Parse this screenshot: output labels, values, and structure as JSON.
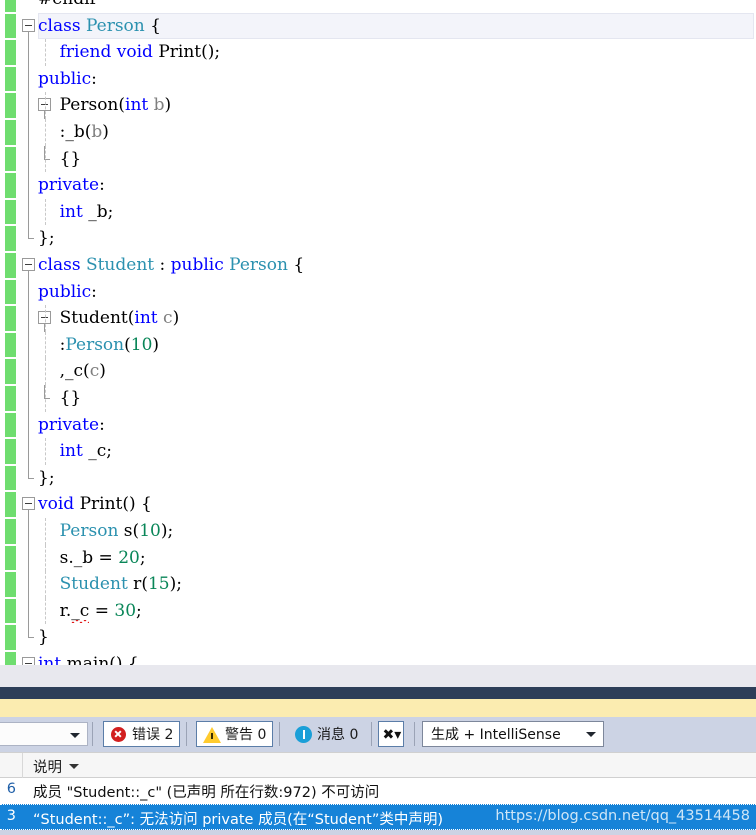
{
  "editor": {
    "lines": [
      {
        "indent": 0,
        "partial_top": true,
        "tokens": [
          {
            "t": "#endif",
            "c": "pln"
          }
        ]
      },
      {
        "indent": 0,
        "outline": "start",
        "current": true,
        "tokens": [
          {
            "t": "class",
            "c": "kw"
          },
          {
            "t": " ",
            "c": "pln"
          },
          {
            "t": "Person",
            "c": "typ"
          },
          {
            "t": " {",
            "c": "pln"
          }
        ]
      },
      {
        "indent": 1,
        "outline": "line",
        "guide": true,
        "tokens": [
          {
            "t": "    ",
            "c": "pln"
          },
          {
            "t": "friend",
            "c": "kw"
          },
          {
            "t": " ",
            "c": "pln"
          },
          {
            "t": "void",
            "c": "kw"
          },
          {
            "t": " ",
            "c": "pln"
          },
          {
            "t": "Print",
            "c": "pln"
          },
          {
            "t": "();",
            "c": "pln"
          }
        ]
      },
      {
        "indent": 0,
        "outline": "line",
        "tokens": [
          {
            "t": "public",
            "c": "kw"
          },
          {
            "t": ":",
            "c": "pln"
          }
        ]
      },
      {
        "indent": 1,
        "outline": "start-inner",
        "guide": true,
        "tokens": [
          {
            "t": "    Person",
            "c": "pln"
          },
          {
            "t": "(",
            "c": "pln"
          },
          {
            "t": "int",
            "c": "kw"
          },
          {
            "t": " ",
            "c": "pln"
          },
          {
            "t": "b",
            "c": "par"
          },
          {
            "t": ")",
            "c": "pln"
          }
        ]
      },
      {
        "indent": 1,
        "outline": "line2",
        "guide": true,
        "tokens": [
          {
            "t": "    :_b",
            "c": "pln"
          },
          {
            "t": "(",
            "c": "pln"
          },
          {
            "t": "b",
            "c": "par"
          },
          {
            "t": ")",
            "c": "pln"
          }
        ]
      },
      {
        "indent": 1,
        "outline": "end-inner",
        "guide": true,
        "tokens": [
          {
            "t": "    {}",
            "c": "pln"
          }
        ]
      },
      {
        "indent": 0,
        "outline": "line",
        "tokens": [
          {
            "t": "private",
            "c": "kw"
          },
          {
            "t": ":",
            "c": "pln"
          }
        ]
      },
      {
        "indent": 1,
        "outline": "line",
        "guide": true,
        "tokens": [
          {
            "t": "    ",
            "c": "pln"
          },
          {
            "t": "int",
            "c": "kw"
          },
          {
            "t": " _b;",
            "c": "pln"
          }
        ]
      },
      {
        "indent": 0,
        "outline": "end",
        "tokens": [
          {
            "t": "};",
            "c": "pln"
          }
        ]
      },
      {
        "indent": 0,
        "outline": "start",
        "tokens": [
          {
            "t": "class",
            "c": "kw"
          },
          {
            "t": " ",
            "c": "pln"
          },
          {
            "t": "Student",
            "c": "typ"
          },
          {
            "t": " : ",
            "c": "pln"
          },
          {
            "t": "public",
            "c": "kw"
          },
          {
            "t": " ",
            "c": "pln"
          },
          {
            "t": "Person",
            "c": "typ"
          },
          {
            "t": " {",
            "c": "pln"
          }
        ]
      },
      {
        "indent": 0,
        "outline": "line",
        "tokens": [
          {
            "t": "public",
            "c": "kw"
          },
          {
            "t": ":",
            "c": "pln"
          }
        ]
      },
      {
        "indent": 1,
        "outline": "start-inner",
        "guide": true,
        "tokens": [
          {
            "t": "    Student",
            "c": "pln"
          },
          {
            "t": "(",
            "c": "pln"
          },
          {
            "t": "int",
            "c": "kw"
          },
          {
            "t": " ",
            "c": "pln"
          },
          {
            "t": "c",
            "c": "par"
          },
          {
            "t": ")",
            "c": "pln"
          }
        ]
      },
      {
        "indent": 1,
        "outline": "line2",
        "guide": true,
        "tokens": [
          {
            "t": "    :",
            "c": "pln"
          },
          {
            "t": "Person",
            "c": "typ"
          },
          {
            "t": "(",
            "c": "pln"
          },
          {
            "t": "10",
            "c": "num"
          },
          {
            "t": ")",
            "c": "pln"
          }
        ]
      },
      {
        "indent": 1,
        "outline": "line2",
        "guide": true,
        "tokens": [
          {
            "t": "    ,_c",
            "c": "pln"
          },
          {
            "t": "(",
            "c": "pln"
          },
          {
            "t": "c",
            "c": "par"
          },
          {
            "t": ")",
            "c": "pln"
          }
        ]
      },
      {
        "indent": 1,
        "outline": "end-inner",
        "guide": true,
        "tokens": [
          {
            "t": "    {}",
            "c": "pln"
          }
        ]
      },
      {
        "indent": 0,
        "outline": "line",
        "tokens": [
          {
            "t": "private",
            "c": "kw"
          },
          {
            "t": ":",
            "c": "pln"
          }
        ]
      },
      {
        "indent": 1,
        "outline": "line",
        "guide": true,
        "tokens": [
          {
            "t": "    ",
            "c": "pln"
          },
          {
            "t": "int",
            "c": "kw"
          },
          {
            "t": " _c;",
            "c": "pln"
          }
        ]
      },
      {
        "indent": 0,
        "outline": "end",
        "tokens": [
          {
            "t": "};",
            "c": "pln"
          }
        ]
      },
      {
        "indent": 0,
        "outline": "start",
        "tokens": [
          {
            "t": "void",
            "c": "kw"
          },
          {
            "t": " Print() {",
            "c": "pln"
          }
        ]
      },
      {
        "indent": 1,
        "outline": "line",
        "guide": true,
        "tokens": [
          {
            "t": "    ",
            "c": "pln"
          },
          {
            "t": "Person",
            "c": "typ"
          },
          {
            "t": " s",
            "c": "pln"
          },
          {
            "t": "(",
            "c": "pln"
          },
          {
            "t": "10",
            "c": "num"
          },
          {
            "t": ");",
            "c": "pln"
          }
        ]
      },
      {
        "indent": 1,
        "outline": "line",
        "guide": true,
        "tokens": [
          {
            "t": "    s._b = ",
            "c": "pln"
          },
          {
            "t": "20",
            "c": "num"
          },
          {
            "t": ";",
            "c": "pln"
          }
        ]
      },
      {
        "indent": 1,
        "outline": "line",
        "guide": true,
        "tokens": [
          {
            "t": "    ",
            "c": "pln"
          },
          {
            "t": "Student",
            "c": "typ"
          },
          {
            "t": " r",
            "c": "pln"
          },
          {
            "t": "(",
            "c": "pln"
          },
          {
            "t": "15",
            "c": "num"
          },
          {
            "t": ");",
            "c": "pln"
          }
        ]
      },
      {
        "indent": 1,
        "outline": "line",
        "guide": true,
        "tokens": [
          {
            "t": "    r.",
            "c": "pln"
          },
          {
            "t": "_c",
            "c": "pln",
            "squiggle": true
          },
          {
            "t": " = ",
            "c": "pln"
          },
          {
            "t": "30",
            "c": "num"
          },
          {
            "t": ";",
            "c": "pln"
          }
        ]
      },
      {
        "indent": 0,
        "outline": "end",
        "tokens": [
          {
            "t": "}",
            "c": "pln"
          }
        ]
      },
      {
        "indent": 0,
        "outline": "start",
        "clipped_bottom": true,
        "tokens": [
          {
            "t": "int",
            "c": "kw"
          },
          {
            "t": " main() {",
            "c": "pln"
          }
        ]
      }
    ]
  },
  "error_list": {
    "toolbar": {
      "left_combo_value": "",
      "error_button": {
        "label": "错误 2",
        "icon": "error-circle-icon"
      },
      "warning_button": {
        "label": "警告 0",
        "icon": "warning-triangle-icon"
      },
      "message_button": {
        "label": "消息 0",
        "icon": "info-circle-icon"
      },
      "filter_button": {
        "icon": "clear-filter-icon"
      },
      "scope_combo": {
        "value": "生成 + IntelliSense",
        "icon": "chevron-down-icon"
      }
    },
    "columns": [
      {
        "label": "说明",
        "sortable": true
      }
    ],
    "rows": [
      {
        "code": "6",
        "description": "成员 \"Student::_c\" (已声明 所在行数:972) 不可访问",
        "selected": false
      },
      {
        "code": "3",
        "description": "“Student::_c”: 无法访问 private 成员(在“Student”类中声明)",
        "selected": true
      }
    ],
    "watermark": "https://blog.csdn.net/qq_43514458"
  },
  "colors": {
    "keyword": "#0000ff",
    "type": "#2b91af",
    "number": "#098658",
    "parameter": "#7f7f7f",
    "change_bar": "#6fdd6f",
    "selection": "#1683d8",
    "panel_bg": "#ccd3e4",
    "dark_bar": "#2d3e58",
    "yellow_bar": "#fbecb0"
  }
}
